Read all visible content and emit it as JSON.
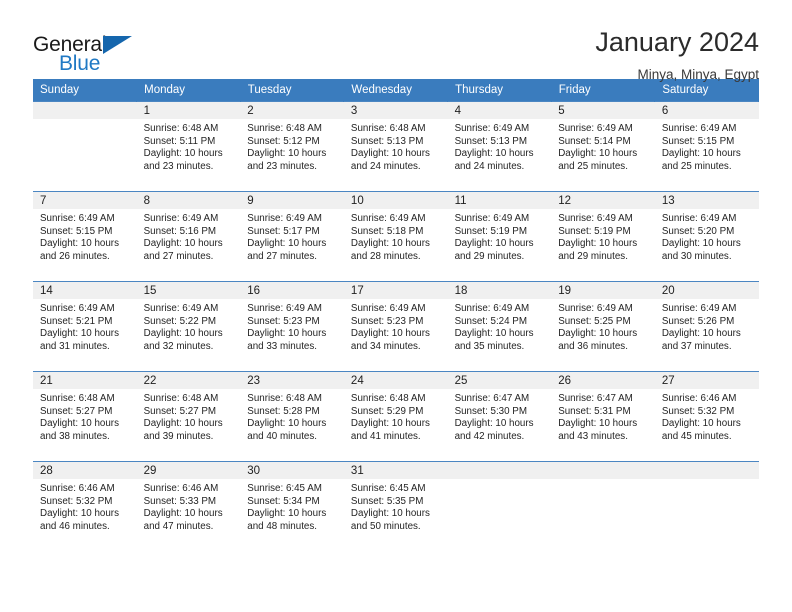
{
  "brand": {
    "word_one": "General",
    "word_two": "Blue",
    "triangle_color": "#1566ad",
    "blue_color": "#2079c4"
  },
  "header": {
    "title": "January 2024",
    "location": "Minya, Minya, Egypt"
  },
  "theme": {
    "header_blue": "#3a7cbe",
    "daynum_gray": "#f0f0f0",
    "grid_line": "#4b86c2"
  },
  "weekdays": [
    "Sunday",
    "Monday",
    "Tuesday",
    "Wednesday",
    "Thursday",
    "Friday",
    "Saturday"
  ],
  "weeks": [
    [
      {
        "day": "",
        "sunrise": "",
        "sunset": "",
        "daylight1": "",
        "daylight2": ""
      },
      {
        "day": "1",
        "sunrise": "Sunrise: 6:48 AM",
        "sunset": "Sunset: 5:11 PM",
        "daylight1": "Daylight: 10 hours",
        "daylight2": "and 23 minutes."
      },
      {
        "day": "2",
        "sunrise": "Sunrise: 6:48 AM",
        "sunset": "Sunset: 5:12 PM",
        "daylight1": "Daylight: 10 hours",
        "daylight2": "and 23 minutes."
      },
      {
        "day": "3",
        "sunrise": "Sunrise: 6:48 AM",
        "sunset": "Sunset: 5:13 PM",
        "daylight1": "Daylight: 10 hours",
        "daylight2": "and 24 minutes."
      },
      {
        "day": "4",
        "sunrise": "Sunrise: 6:49 AM",
        "sunset": "Sunset: 5:13 PM",
        "daylight1": "Daylight: 10 hours",
        "daylight2": "and 24 minutes."
      },
      {
        "day": "5",
        "sunrise": "Sunrise: 6:49 AM",
        "sunset": "Sunset: 5:14 PM",
        "daylight1": "Daylight: 10 hours",
        "daylight2": "and 25 minutes."
      },
      {
        "day": "6",
        "sunrise": "Sunrise: 6:49 AM",
        "sunset": "Sunset: 5:15 PM",
        "daylight1": "Daylight: 10 hours",
        "daylight2": "and 25 minutes."
      }
    ],
    [
      {
        "day": "7",
        "sunrise": "Sunrise: 6:49 AM",
        "sunset": "Sunset: 5:15 PM",
        "daylight1": "Daylight: 10 hours",
        "daylight2": "and 26 minutes."
      },
      {
        "day": "8",
        "sunrise": "Sunrise: 6:49 AM",
        "sunset": "Sunset: 5:16 PM",
        "daylight1": "Daylight: 10 hours",
        "daylight2": "and 27 minutes."
      },
      {
        "day": "9",
        "sunrise": "Sunrise: 6:49 AM",
        "sunset": "Sunset: 5:17 PM",
        "daylight1": "Daylight: 10 hours",
        "daylight2": "and 27 minutes."
      },
      {
        "day": "10",
        "sunrise": "Sunrise: 6:49 AM",
        "sunset": "Sunset: 5:18 PM",
        "daylight1": "Daylight: 10 hours",
        "daylight2": "and 28 minutes."
      },
      {
        "day": "11",
        "sunrise": "Sunrise: 6:49 AM",
        "sunset": "Sunset: 5:19 PM",
        "daylight1": "Daylight: 10 hours",
        "daylight2": "and 29 minutes."
      },
      {
        "day": "12",
        "sunrise": "Sunrise: 6:49 AM",
        "sunset": "Sunset: 5:19 PM",
        "daylight1": "Daylight: 10 hours",
        "daylight2": "and 29 minutes."
      },
      {
        "day": "13",
        "sunrise": "Sunrise: 6:49 AM",
        "sunset": "Sunset: 5:20 PM",
        "daylight1": "Daylight: 10 hours",
        "daylight2": "and 30 minutes."
      }
    ],
    [
      {
        "day": "14",
        "sunrise": "Sunrise: 6:49 AM",
        "sunset": "Sunset: 5:21 PM",
        "daylight1": "Daylight: 10 hours",
        "daylight2": "and 31 minutes."
      },
      {
        "day": "15",
        "sunrise": "Sunrise: 6:49 AM",
        "sunset": "Sunset: 5:22 PM",
        "daylight1": "Daylight: 10 hours",
        "daylight2": "and 32 minutes."
      },
      {
        "day": "16",
        "sunrise": "Sunrise: 6:49 AM",
        "sunset": "Sunset: 5:23 PM",
        "daylight1": "Daylight: 10 hours",
        "daylight2": "and 33 minutes."
      },
      {
        "day": "17",
        "sunrise": "Sunrise: 6:49 AM",
        "sunset": "Sunset: 5:23 PM",
        "daylight1": "Daylight: 10 hours",
        "daylight2": "and 34 minutes."
      },
      {
        "day": "18",
        "sunrise": "Sunrise: 6:49 AM",
        "sunset": "Sunset: 5:24 PM",
        "daylight1": "Daylight: 10 hours",
        "daylight2": "and 35 minutes."
      },
      {
        "day": "19",
        "sunrise": "Sunrise: 6:49 AM",
        "sunset": "Sunset: 5:25 PM",
        "daylight1": "Daylight: 10 hours",
        "daylight2": "and 36 minutes."
      },
      {
        "day": "20",
        "sunrise": "Sunrise: 6:49 AM",
        "sunset": "Sunset: 5:26 PM",
        "daylight1": "Daylight: 10 hours",
        "daylight2": "and 37 minutes."
      }
    ],
    [
      {
        "day": "21",
        "sunrise": "Sunrise: 6:48 AM",
        "sunset": "Sunset: 5:27 PM",
        "daylight1": "Daylight: 10 hours",
        "daylight2": "and 38 minutes."
      },
      {
        "day": "22",
        "sunrise": "Sunrise: 6:48 AM",
        "sunset": "Sunset: 5:27 PM",
        "daylight1": "Daylight: 10 hours",
        "daylight2": "and 39 minutes."
      },
      {
        "day": "23",
        "sunrise": "Sunrise: 6:48 AM",
        "sunset": "Sunset: 5:28 PM",
        "daylight1": "Daylight: 10 hours",
        "daylight2": "and 40 minutes."
      },
      {
        "day": "24",
        "sunrise": "Sunrise: 6:48 AM",
        "sunset": "Sunset: 5:29 PM",
        "daylight1": "Daylight: 10 hours",
        "daylight2": "and 41 minutes."
      },
      {
        "day": "25",
        "sunrise": "Sunrise: 6:47 AM",
        "sunset": "Sunset: 5:30 PM",
        "daylight1": "Daylight: 10 hours",
        "daylight2": "and 42 minutes."
      },
      {
        "day": "26",
        "sunrise": "Sunrise: 6:47 AM",
        "sunset": "Sunset: 5:31 PM",
        "daylight1": "Daylight: 10 hours",
        "daylight2": "and 43 minutes."
      },
      {
        "day": "27",
        "sunrise": "Sunrise: 6:46 AM",
        "sunset": "Sunset: 5:32 PM",
        "daylight1": "Daylight: 10 hours",
        "daylight2": "and 45 minutes."
      }
    ],
    [
      {
        "day": "28",
        "sunrise": "Sunrise: 6:46 AM",
        "sunset": "Sunset: 5:32 PM",
        "daylight1": "Daylight: 10 hours",
        "daylight2": "and 46 minutes."
      },
      {
        "day": "29",
        "sunrise": "Sunrise: 6:46 AM",
        "sunset": "Sunset: 5:33 PM",
        "daylight1": "Daylight: 10 hours",
        "daylight2": "and 47 minutes."
      },
      {
        "day": "30",
        "sunrise": "Sunrise: 6:45 AM",
        "sunset": "Sunset: 5:34 PM",
        "daylight1": "Daylight: 10 hours",
        "daylight2": "and 48 minutes."
      },
      {
        "day": "31",
        "sunrise": "Sunrise: 6:45 AM",
        "sunset": "Sunset: 5:35 PM",
        "daylight1": "Daylight: 10 hours",
        "daylight2": "and 50 minutes."
      },
      {
        "day": "",
        "sunrise": "",
        "sunset": "",
        "daylight1": "",
        "daylight2": ""
      },
      {
        "day": "",
        "sunrise": "",
        "sunset": "",
        "daylight1": "",
        "daylight2": ""
      },
      {
        "day": "",
        "sunrise": "",
        "sunset": "",
        "daylight1": "",
        "daylight2": ""
      }
    ]
  ]
}
